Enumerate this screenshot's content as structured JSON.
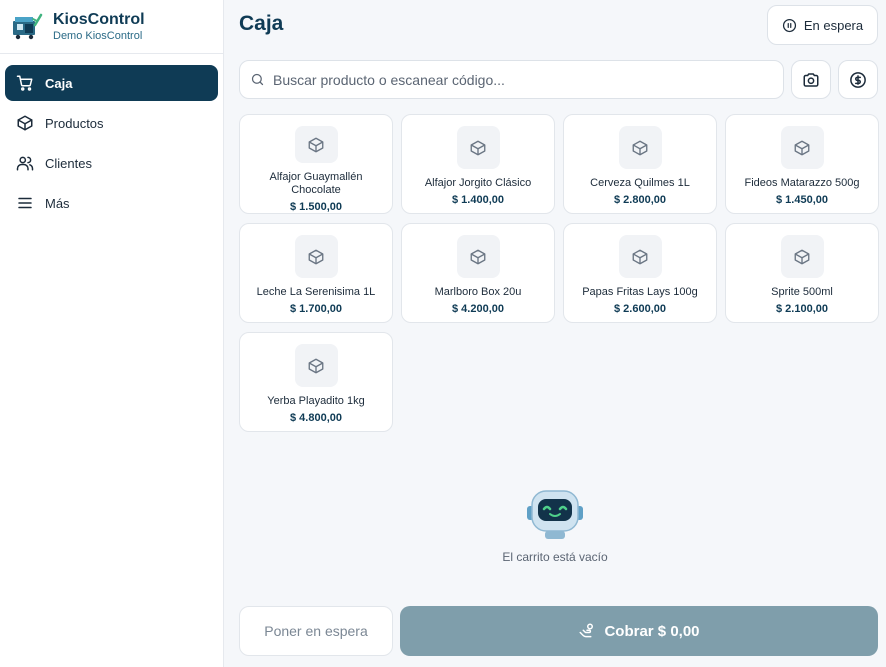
{
  "brand": {
    "name": "KiosControl",
    "subtitle": "Demo KiosControl"
  },
  "sidebar": {
    "items": [
      {
        "label": "Caja",
        "icon": "cart-icon",
        "active": true
      },
      {
        "label": "Productos",
        "icon": "box-icon",
        "active": false
      },
      {
        "label": "Clientes",
        "icon": "users-icon",
        "active": false
      },
      {
        "label": "Más",
        "icon": "menu-icon",
        "active": false
      }
    ]
  },
  "header": {
    "title": "Caja",
    "hold_label": "En espera"
  },
  "search": {
    "placeholder": "Buscar producto o escanear código..."
  },
  "products": [
    {
      "name": "Alfajor Guaymallén Chocolate",
      "price": "$ 1.500,00"
    },
    {
      "name": "Alfajor Jorgito Clásico",
      "price": "$ 1.400,00"
    },
    {
      "name": "Cerveza Quilmes 1L",
      "price": "$ 2.800,00"
    },
    {
      "name": "Fideos Matarazzo 500g",
      "price": "$ 1.450,00"
    },
    {
      "name": "Leche La Serenisima 1L",
      "price": "$ 1.700,00"
    },
    {
      "name": "Marlboro Box 20u",
      "price": "$ 4.200,00"
    },
    {
      "name": "Papas Fritas Lays 100g",
      "price": "$ 2.600,00"
    },
    {
      "name": "Sprite 500ml",
      "price": "$ 2.100,00"
    },
    {
      "name": "Yerba Playadito 1kg",
      "price": "$ 4.800,00"
    }
  ],
  "cart": {
    "empty_text": "El carrito está vacío"
  },
  "footer": {
    "put_on_hold_label": "Poner en espera",
    "charge_label": "Cobrar $ 0,00"
  },
  "colors": {
    "primary": "#0f3b55",
    "charge_disabled": "#7f9eab",
    "background": "#f5f7fa"
  }
}
